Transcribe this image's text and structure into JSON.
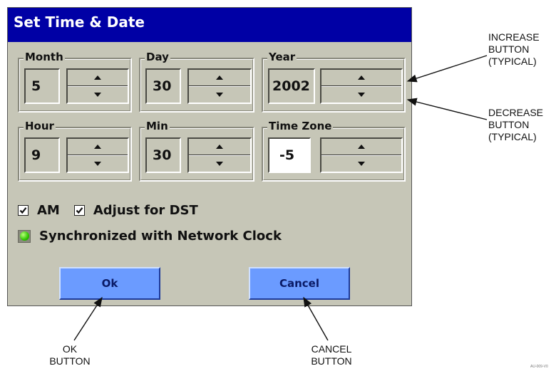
{
  "dialog": {
    "title": "Set Time & Date",
    "fields": [
      {
        "label": "Month",
        "value": "5"
      },
      {
        "label": "Day",
        "value": "30"
      },
      {
        "label": "Year",
        "value": "2002"
      },
      {
        "label": "Hour",
        "value": "9"
      },
      {
        "label": "Min",
        "value": "30"
      },
      {
        "label": "Time Zone",
        "value": "-5"
      }
    ],
    "checkboxes": [
      {
        "label": "AM",
        "checked": true
      },
      {
        "label": "Adjust for DST",
        "checked": true
      }
    ],
    "status": {
      "label": "Synchronized with Network Clock",
      "indicator_color": "#2fc400",
      "icon": "status-led-icon"
    },
    "buttons": {
      "ok_label": "Ok",
      "cancel_label": "Cancel"
    }
  },
  "callouts": {
    "increase": "INCREASE\nBUTTON\n(TYPICAL)",
    "decrease": "DECREASE\nBUTTON\n(TYPICAL)",
    "ok": "OK\nBUTTON",
    "cancel": "CANCEL\nBUTTON"
  },
  "figure_code": "AU-009-V0",
  "colors": {
    "titlebar": "#0000a5",
    "dialog_bg": "#c6c6b7",
    "button_bg": "#6b9bff"
  }
}
